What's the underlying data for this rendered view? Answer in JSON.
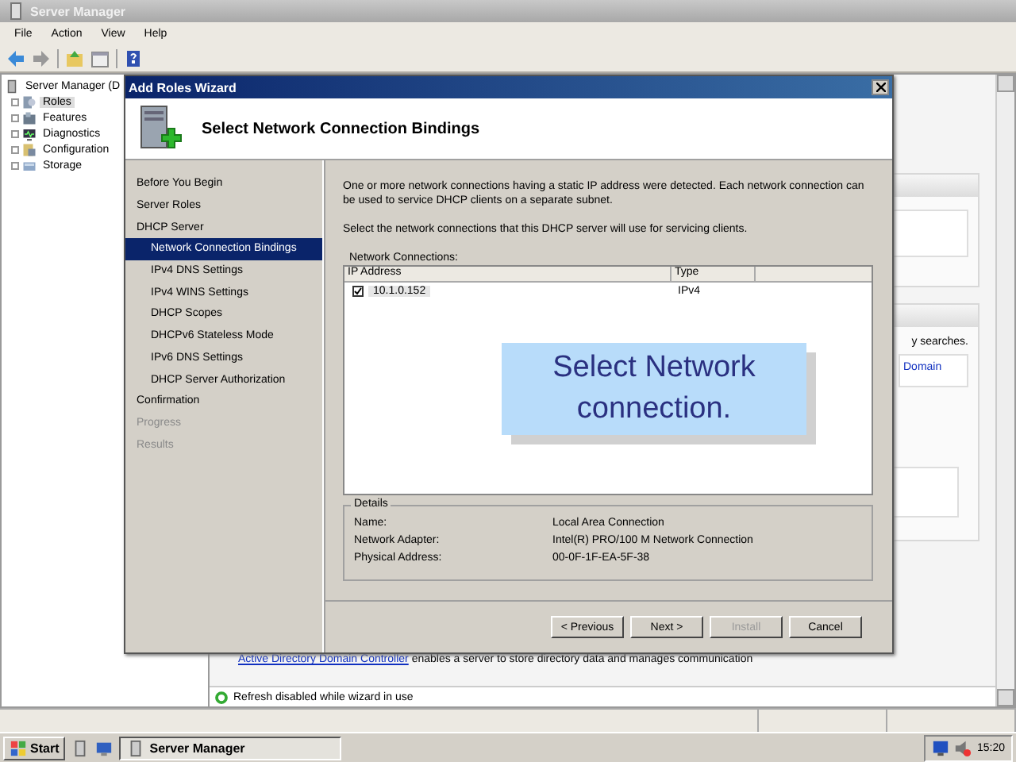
{
  "window": {
    "title": "Server Manager"
  },
  "menu": [
    "File",
    "Action",
    "View",
    "Help"
  ],
  "tree": {
    "root": "Server Manager (D",
    "items": [
      {
        "label": "Roles",
        "selected": true
      },
      {
        "label": "Features",
        "selected": false
      },
      {
        "label": "Diagnostics",
        "selected": false
      },
      {
        "label": "Configuration",
        "selected": false
      },
      {
        "label": "Storage",
        "selected": false
      }
    ]
  },
  "background": {
    "fragments": [
      "y searches.",
      "Domain"
    ],
    "link": "Active Directory Domain Controller",
    "description": "enables a server to store directory data and manages communication",
    "status": "Refresh disabled while wizard in use"
  },
  "wizard": {
    "title": "Add Roles Wizard",
    "heading": "Select Network Connection Bindings",
    "steps": [
      {
        "label": "Before You Begin",
        "selected": false,
        "disabled": false
      },
      {
        "label": "Server Roles",
        "selected": false,
        "disabled": false
      },
      {
        "label": "DHCP Server",
        "selected": false,
        "disabled": false,
        "children": [
          {
            "label": "Network Connection Bindings",
            "selected": true,
            "disabled": false
          },
          {
            "label": "IPv4 DNS Settings",
            "selected": false,
            "disabled": false
          },
          {
            "label": "IPv4 WINS Settings",
            "selected": false,
            "disabled": false
          },
          {
            "label": "DHCP Scopes",
            "selected": false,
            "disabled": false
          },
          {
            "label": "DHCPv6 Stateless Mode",
            "selected": false,
            "disabled": false
          },
          {
            "label": "IPv6 DNS Settings",
            "selected": false,
            "disabled": false
          },
          {
            "label": "DHCP Server Authorization",
            "selected": false,
            "disabled": false
          }
        ]
      },
      {
        "label": "Confirmation",
        "selected": false,
        "disabled": false
      },
      {
        "label": "Progress",
        "selected": false,
        "disabled": true
      },
      {
        "label": "Results",
        "selected": false,
        "disabled": true
      }
    ],
    "intro": "One or more network connections having a static IP address were detected. Each network connection can be used to service DHCP clients on a separate subnet.",
    "instruction": "Select the network connections that this DHCP server will use for servicing clients.",
    "list_label": "Network Connections:",
    "columns": [
      "IP Address",
      "Type"
    ],
    "rows": [
      {
        "checked": true,
        "ip_address": "10.1.0.152",
        "type": "IPv4"
      }
    ],
    "details": {
      "title": "Details",
      "fields": [
        {
          "label": "Name:",
          "value": "Local Area Connection"
        },
        {
          "label": "Network Adapter:",
          "value": "Intel(R) PRO/100 M Network Connection"
        },
        {
          "label": "Physical Address:",
          "value": "00-0F-1F-EA-5F-38"
        }
      ]
    },
    "buttons": [
      {
        "label": "< Previous",
        "disabled": false
      },
      {
        "label": "Next >",
        "disabled": false
      },
      {
        "label": "Install",
        "disabled": true
      },
      {
        "label": "Cancel",
        "disabled": false
      }
    ],
    "callout": "Select Network connection."
  },
  "taskbar": {
    "start": "Start",
    "tasks": [
      {
        "label": "Server Manager",
        "selected": true
      }
    ],
    "clock": "15:20"
  }
}
